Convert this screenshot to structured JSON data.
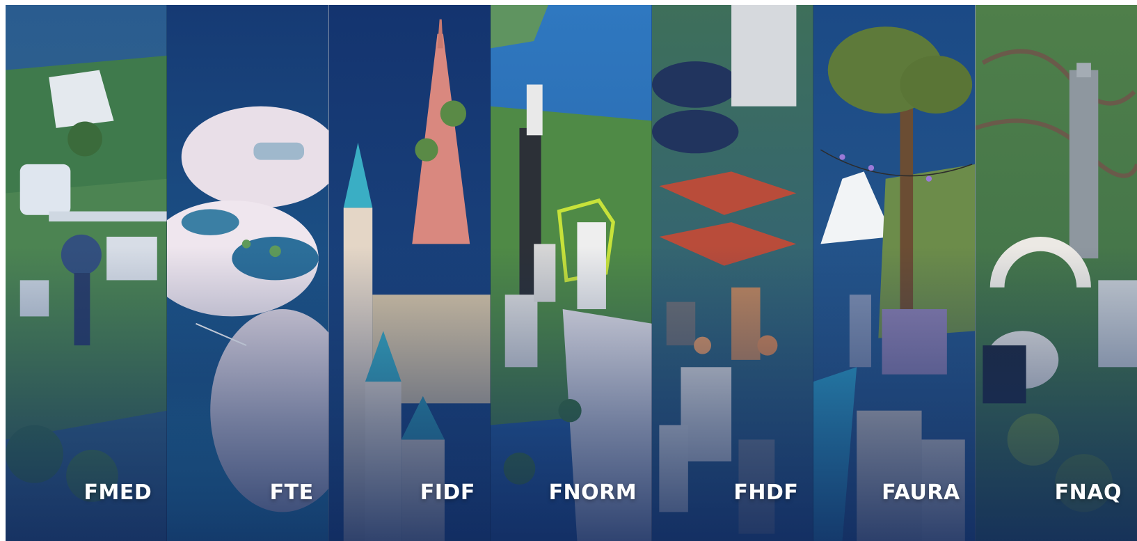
{
  "panels": [
    {
      "id": "fmed",
      "label": "FMED",
      "sky": "#1f4f86",
      "ground": "#3f7a4c",
      "accent": "#d8e2ec"
    },
    {
      "id": "fte",
      "label": "FTE",
      "sky": "#173a76",
      "ground": "#e8dde6",
      "accent": "#2e9fd1"
    },
    {
      "id": "fidf",
      "label": "FIDF",
      "sky": "#163a78",
      "ground": "#d9c7b6",
      "accent": "#3aaec4"
    },
    {
      "id": "fnorm",
      "label": "FNORM",
      "sky": "#2a6fb8",
      "ground": "#4f8a46",
      "accent": "#c7e23a"
    },
    {
      "id": "fhdf",
      "label": "FHDF",
      "sky": "#1d4787",
      "ground": "#4e8340",
      "accent": "#b94c3a"
    },
    {
      "id": "faura",
      "label": "FAURA",
      "sky": "#1b4a86",
      "ground": "#6c8c4a",
      "accent": "#9b7ad8"
    },
    {
      "id": "fnaq",
      "label": "FNAQ",
      "sky": "#2c5e72",
      "ground": "#6f9a3e",
      "accent": "#9aa4ad"
    }
  ]
}
